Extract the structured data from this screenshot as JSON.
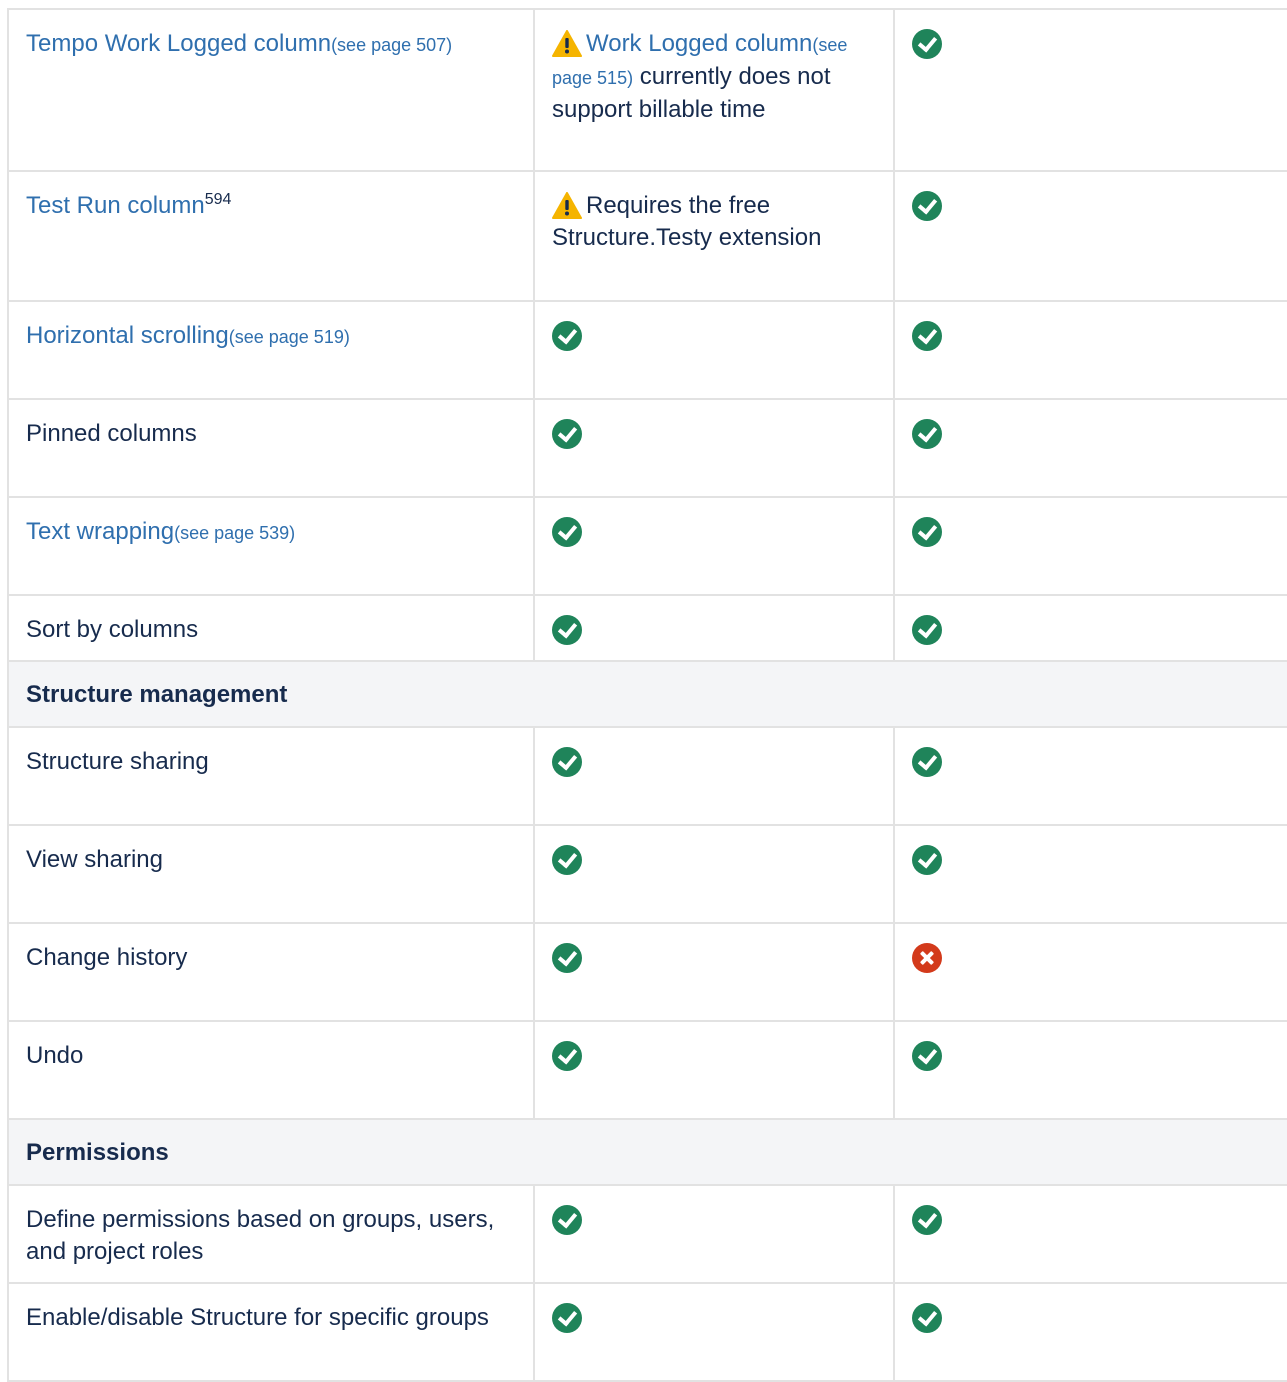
{
  "rows": [
    {
      "feature": {
        "text": "Tempo Work Logged column",
        "ref": "(see page 507)"
      },
      "col2_note": {
        "link": "Work Logged column",
        "ref_a": "(see",
        "ref_b": "page 515)",
        "text_a": "currently does not",
        "text_b": "support billable time"
      },
      "col3": "check"
    },
    {
      "feature": {
        "text": "Test Run column",
        "sup": "594"
      },
      "col2_note": {
        "line1": "Requires the free",
        "line2": "Structure.Testy extension"
      },
      "col3": "check"
    },
    {
      "feature": {
        "text": "Horizontal scrolling",
        "ref": "(see page 519)"
      },
      "col2": "check",
      "col3": "check"
    },
    {
      "feature": {
        "text": "Pinned columns"
      },
      "col2": "check",
      "col3": "check"
    },
    {
      "feature": {
        "text": "Text wrapping",
        "ref": "(see page 539)"
      },
      "col2": "check",
      "col3": "check"
    },
    {
      "feature": {
        "text": "Sort by columns"
      },
      "col2": "check",
      "col3": "check"
    }
  ],
  "sections": {
    "structure_management": {
      "title": "Structure management",
      "rows": [
        {
          "feature": "Structure sharing",
          "col2": "check",
          "col3": "check"
        },
        {
          "feature": "View sharing",
          "col2": "check",
          "col3": "check"
        },
        {
          "feature": "Change history",
          "col2": "check",
          "col3": "cross"
        },
        {
          "feature": "Undo",
          "col2": "check",
          "col3": "check"
        }
      ]
    },
    "permissions": {
      "title": "Permissions",
      "rows": [
        {
          "feature_a": "Define permissions based on groups, users,",
          "feature_b": "and project roles",
          "col2": "check",
          "col3": "check"
        },
        {
          "feature": "Enable/disable Structure for specific groups",
          "col2": "check",
          "col3": "check"
        }
      ]
    }
  },
  "icons": {
    "check": "check-circle-icon",
    "cross": "cross-circle-icon",
    "warning": "warning-icon"
  },
  "colors": {
    "link": "#2f6fae",
    "check": "#1f845a",
    "cross": "#d33a1b",
    "warning": "#f5b400",
    "section_bg": "#f4f5f7",
    "border": "#e2e2e2"
  }
}
